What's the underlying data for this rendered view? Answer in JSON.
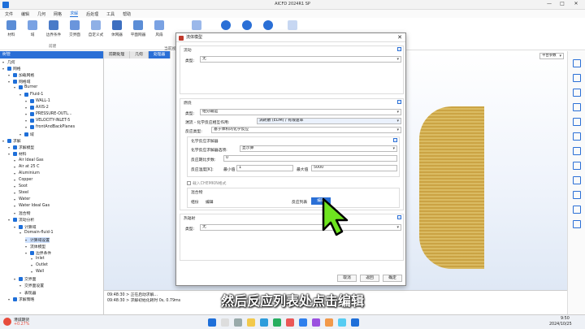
{
  "window": {
    "title": "AICFD 2024R1 SP",
    "min": "—",
    "max": "□",
    "close": "✕"
  },
  "menu": [
    "文件",
    "编辑",
    "几何",
    "网格",
    "求解",
    "后处理",
    "工具",
    "帮助"
  ],
  "ribbon": {
    "buttons": [
      "材料",
      "域",
      "边界条件",
      "交界面",
      "自定义式",
      "体网器",
      "平面网器",
      "风扇"
    ],
    "group_label": "前建",
    "colors": {
      "blue": "#2a6fd6",
      "accent": "#c0392b"
    }
  },
  "left_panel": {
    "header": "树管",
    "tree": [
      {
        "label": "几何",
        "level": 0,
        "check": false
      },
      {
        "label": "网格",
        "level": 0,
        "check": true
      },
      {
        "label": "加载网格",
        "level": 1,
        "check": true
      },
      {
        "label": "网格域",
        "level": 1,
        "check": true
      },
      {
        "label": "Burner",
        "level": 2,
        "check": true
      },
      {
        "label": "Fluid-1",
        "level": 3,
        "check": true
      },
      {
        "label": "WALL-1",
        "level": 4,
        "check": true
      },
      {
        "label": "AXIS-2",
        "level": 4,
        "check": true
      },
      {
        "label": "PRESSURE-OUTL...",
        "level": 4,
        "check": true
      },
      {
        "label": "VELOCITY-INLET-5",
        "level": 4,
        "check": true
      },
      {
        "label": "frontAndBackPlanes",
        "level": 4,
        "check": true
      },
      {
        "label": "域",
        "level": 3,
        "check": true
      },
      {
        "label": "求解",
        "level": 0,
        "check": true
      },
      {
        "label": "求解模型",
        "level": 1,
        "check": true
      },
      {
        "label": "材料",
        "level": 1,
        "check": true
      },
      {
        "label": "Air Ideal Gas",
        "level": 2,
        "check": false
      },
      {
        "label": "Air at 25 C",
        "level": 2,
        "check": false
      },
      {
        "label": "Aluminium",
        "level": 2,
        "check": false
      },
      {
        "label": "Copper",
        "level": 2,
        "check": false
      },
      {
        "label": "Soot",
        "level": 2,
        "check": false
      },
      {
        "label": "Steel",
        "level": 2,
        "check": false
      },
      {
        "label": "Water",
        "level": 2,
        "check": false
      },
      {
        "label": "Water Ideal Gas",
        "level": 2,
        "check": false
      },
      {
        "label": "混合物",
        "level": 2,
        "check": false
      },
      {
        "label": "流动分析",
        "level": 1,
        "check": true
      },
      {
        "label": "计算域",
        "level": 2,
        "check": true
      },
      {
        "label": "Domain-fluid-1",
        "level": 3,
        "check": false
      },
      {
        "label": "计算域设置",
        "level": 4,
        "check": false,
        "selected": true
      },
      {
        "label": "流体模型",
        "level": 4,
        "check": false
      },
      {
        "label": "边界条件",
        "level": 4,
        "check": true
      },
      {
        "label": "Inlet",
        "level": 5,
        "check": false
      },
      {
        "label": "Outlet",
        "level": 5,
        "check": false
      },
      {
        "label": "Wall",
        "level": 5,
        "check": false
      },
      {
        "label": "交界面",
        "level": 2,
        "check": true
      },
      {
        "label": "交界面设置",
        "level": 3,
        "check": false
      },
      {
        "label": "表现器",
        "level": 3,
        "check": false
      },
      {
        "label": "求解策略",
        "level": 1,
        "check": true
      }
    ]
  },
  "viewport": {
    "tabs": [
      "前期处理",
      "几何",
      "处理器"
    ],
    "active_tab": 2,
    "view_label": "当前视图",
    "right_select": "平台参数"
  },
  "log": [
    "09:48:30 > 正在启动求解...",
    "09:48:30 > 求解初始化耗时 0s, 0.79ms"
  ],
  "dialog": {
    "title": "流体模型",
    "sec1_title": "流动",
    "sec1_label": "类型:",
    "sec1_value": "无",
    "sec2_title": "燃烧",
    "type_label": "类型:",
    "type_value": "组分输运",
    "turb_label": "湍流 - 化学反应相互作用:",
    "turb_value": "涡耗散 (EDM) / 有限速率",
    "react_label": "反应类型:",
    "react_value": "基于体积的化学反应",
    "solver_title": "化学反应求解器",
    "solver_label": "化学反应求解器选项:",
    "solver_value": "显示算",
    "steps_label": "反应期比步数:",
    "steps_value": "0",
    "temp_label": "反应温度[K]:",
    "min_label": "最小值",
    "min_value": "1",
    "max_label": "最大值",
    "max_value": "5000",
    "chem_check": "载入CHEMKIN格式",
    "mix_title": "混合物",
    "mix_label": "组份",
    "mix_edit": "编辑",
    "reaction_list": "反应列表",
    "reaction_edit": "编辑",
    "sec3_title": "热辐射",
    "sec3_label": "类型:",
    "sec3_value": "无",
    "cancel": "取消",
    "back": "返回",
    "ok": "确定"
  },
  "subtitle": "然后反应列表处点击编辑",
  "taskbar": {
    "stock_name": "港诚期货",
    "stock_change": "+0.27%",
    "time": "9:50",
    "date": "2024/10/25"
  }
}
